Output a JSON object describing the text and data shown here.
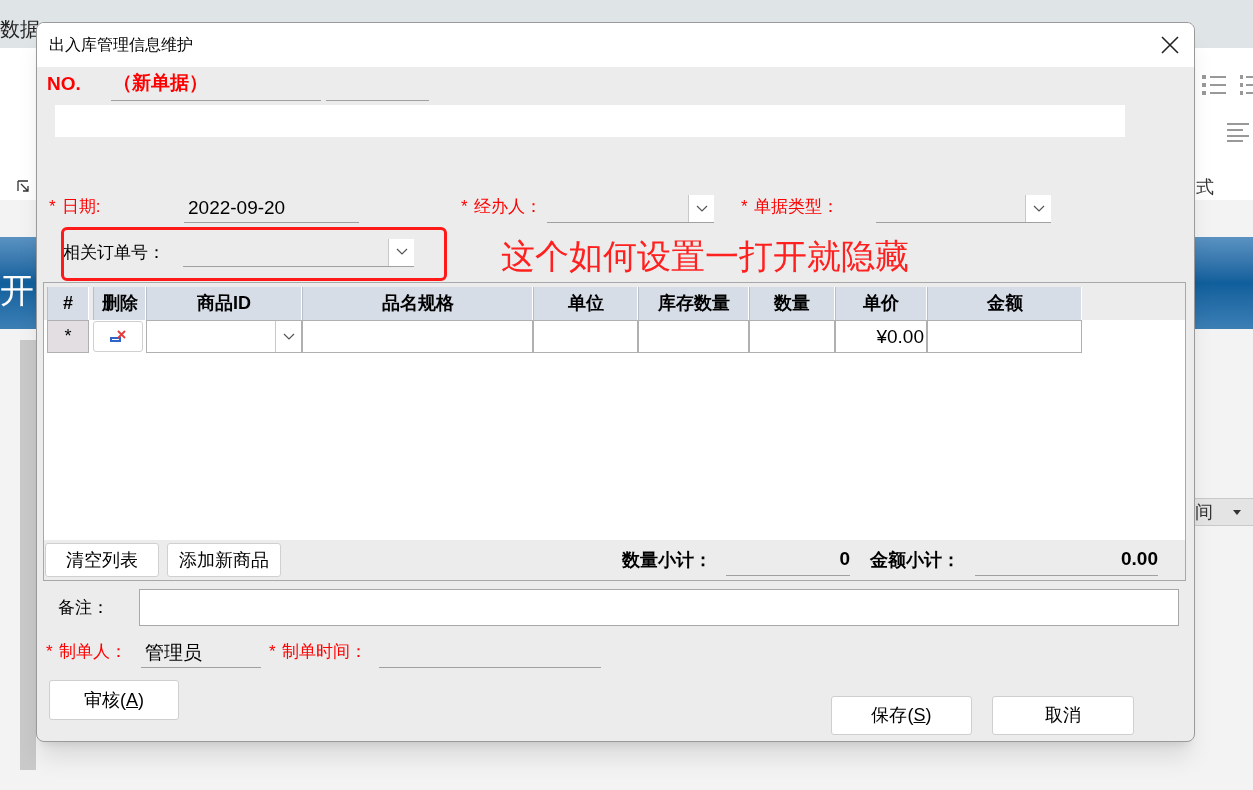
{
  "app_behind": {
    "menu_text": "数据",
    "ribbon_label": "式",
    "banner_text": "开",
    "column_header": "间"
  },
  "dialog": {
    "title": "出入库管理信息维护",
    "number": {
      "label": "NO.",
      "value": "（新单据）"
    },
    "header_fields": [
      {
        "mark": "*",
        "label": "日期:",
        "kind": "text",
        "value": "2022-09-20"
      },
      {
        "mark": "*",
        "label": "经办人：",
        "kind": "combo"
      },
      {
        "mark": "*",
        "label": "单据类型：",
        "kind": "combo"
      }
    ],
    "related_order": {
      "label": "相关订单号：",
      "kind": "combo"
    },
    "annotation": {
      "text": "这个如何设置一打开就隐藏"
    },
    "grid": {
      "columns": [
        "#",
        "删除",
        "商品ID",
        "品名规格",
        "单位",
        "库存数量",
        "数量",
        "单价",
        "金额"
      ],
      "rows": [
        {
          "marker": "*",
          "unit_price": "¥0.00"
        }
      ]
    },
    "grid_buttons": [
      "清空列表",
      "添加新商品"
    ],
    "totals": [
      {
        "label": "数量小计：",
        "value": "0"
      },
      {
        "label": "金额小计：",
        "value": "0.00"
      }
    ],
    "remarks": {
      "label": "备注："
    },
    "footer_fields": [
      {
        "mark": "*",
        "label": "制单人：",
        "value": "管理员"
      },
      {
        "mark": "*",
        "label": "制单时间："
      }
    ],
    "buttons": [
      {
        "label": "审核(",
        "access_key": "A",
        "label_after": ")"
      },
      {
        "label": "保存(",
        "access_key": "S",
        "label_after": ")"
      },
      {
        "label": "取消"
      }
    ]
  }
}
